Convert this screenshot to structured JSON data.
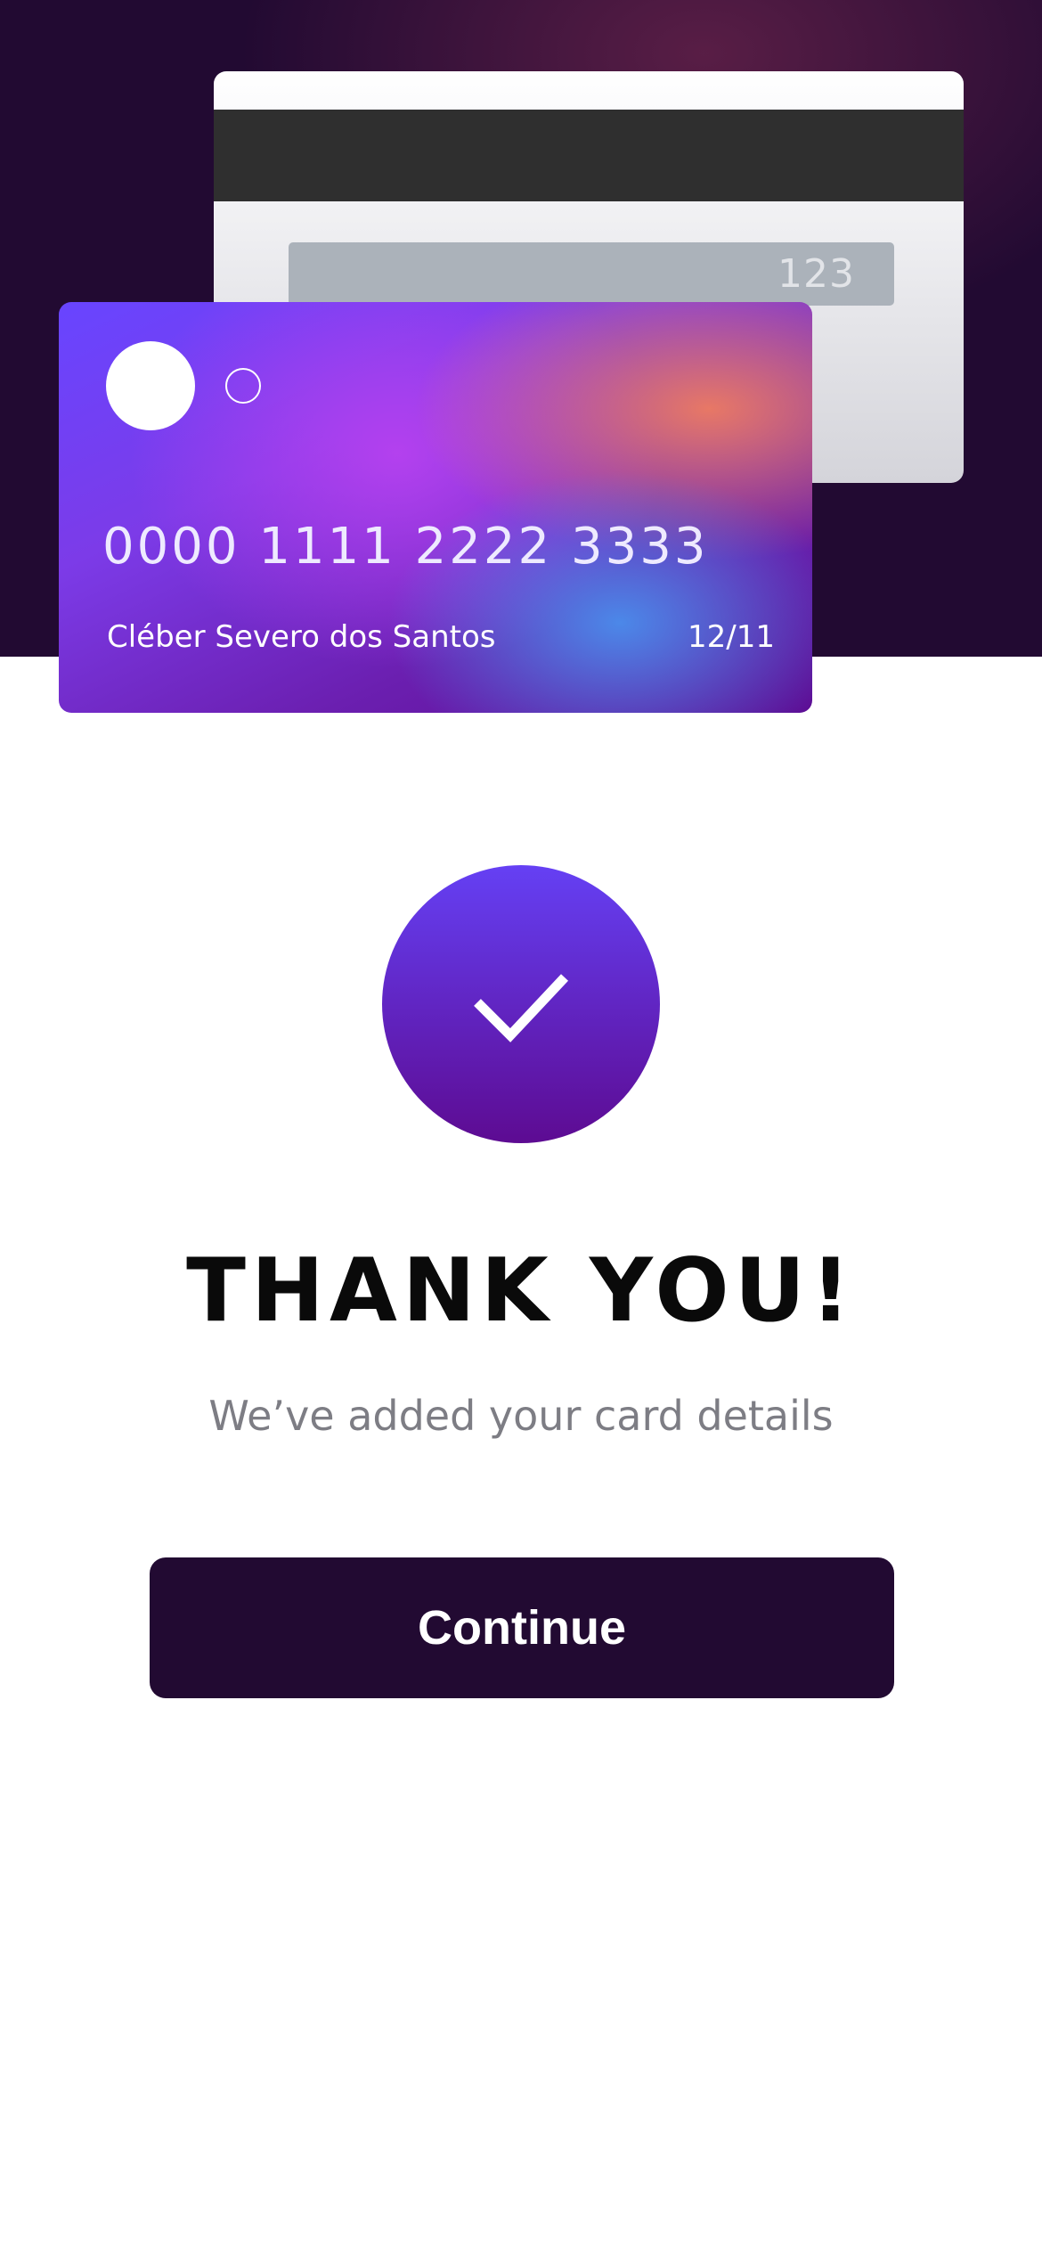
{
  "card_back": {
    "cvc": "123"
  },
  "card_front": {
    "number": "0000 1111 2222 3333",
    "holder_name": "Cléber Severo dos Santos",
    "expiry": "12/11"
  },
  "success": {
    "title": "THANK YOU!",
    "subtitle": "We’ve added your card details",
    "icon": "check-icon"
  },
  "actions": {
    "continue_label": "Continue"
  },
  "colors": {
    "hero_background": "#220a32",
    "accent_start": "#6540f4",
    "accent_end": "#5d0b92",
    "button_background": "#220a32"
  }
}
